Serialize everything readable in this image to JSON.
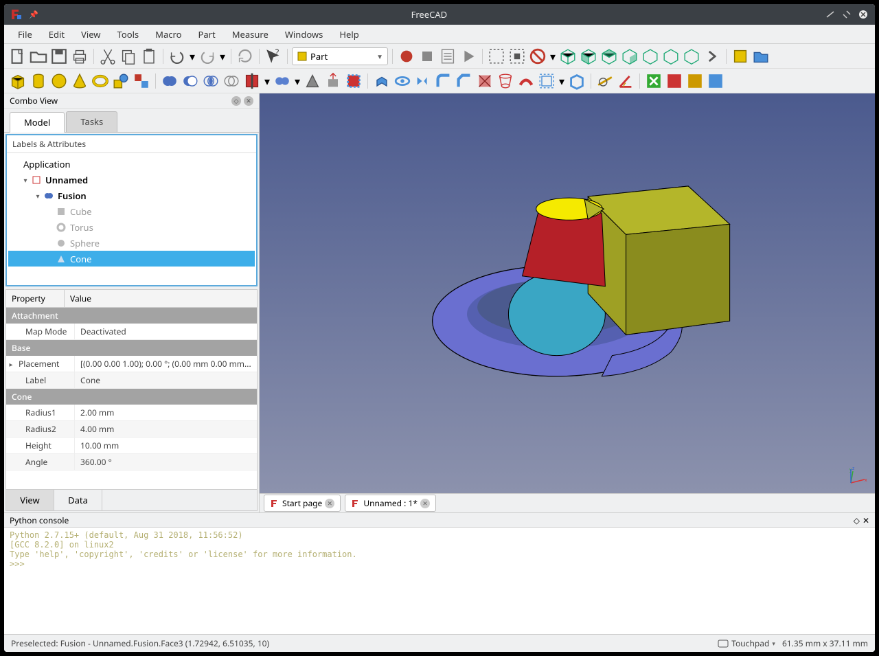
{
  "title": "FreeCAD",
  "menu": [
    "File",
    "Edit",
    "View",
    "Tools",
    "Macro",
    "Part",
    "Measure",
    "Windows",
    "Help"
  ],
  "workbench_selected": "Part",
  "combo_view": {
    "title": "Combo View",
    "tabs": [
      "Model",
      "Tasks"
    ],
    "active_tab": "Model",
    "labels_header": "Labels & Attributes",
    "tree": {
      "root": "Application",
      "doc": "Unnamed",
      "fusion": "Fusion",
      "items": [
        "Cube",
        "Torus",
        "Sphere",
        "Cone"
      ],
      "selected": "Cone"
    },
    "properties": {
      "headers": [
        "Property",
        "Value"
      ],
      "groups": {
        "Attachment": [
          {
            "k": "Map Mode",
            "v": "Deactivated"
          }
        ],
        "Base": [
          {
            "k": "Placement",
            "v": "[(0.00 0.00 1.00); 0.00 °; (0.00 mm  0.00 mm...",
            "expandable": true
          },
          {
            "k": "Label",
            "v": "Cone"
          }
        ],
        "Cone": [
          {
            "k": "Radius1",
            "v": "2.00 mm"
          },
          {
            "k": "Radius2",
            "v": "4.00 mm"
          },
          {
            "k": "Height",
            "v": "10.00 mm"
          },
          {
            "k": "Angle",
            "v": "360.00 °"
          }
        ]
      },
      "bottom_tabs": [
        "View",
        "Data"
      ],
      "bottom_active": "View"
    }
  },
  "doc_tabs": [
    {
      "label": "Start page"
    },
    {
      "label": "Unnamed : 1*"
    }
  ],
  "console": {
    "title": "Python console",
    "text": "Python 2.7.15+ (default, Aug 31 2018, 11:56:52)\n[GCC 8.2.0] on linux2\nType 'help', 'copyright', 'credits' or 'license' for more information.\n>>> "
  },
  "status": {
    "left": "Preselected: Fusion - Unnamed.Fusion.Face3 (1.72942, 6.51035, 10)",
    "nav": "Touchpad",
    "dims": "61.35 mm x 37.11 mm"
  }
}
